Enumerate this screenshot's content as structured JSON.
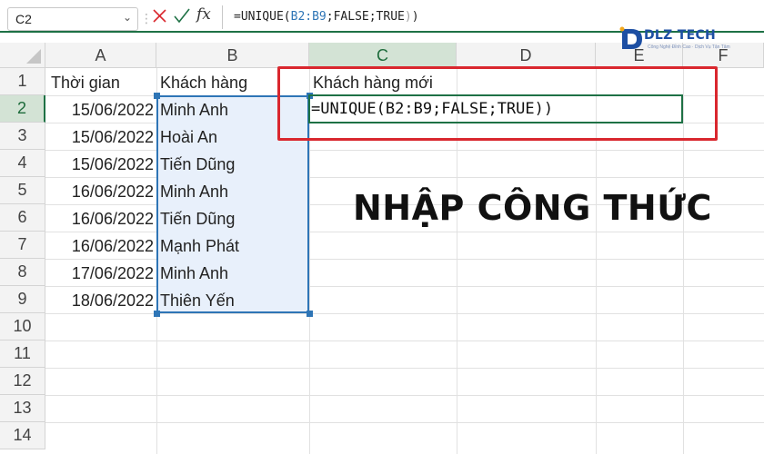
{
  "formula_bar": {
    "name_box": "C2",
    "formula_parts": [
      "=UNIQUE(",
      "B2:B9",
      ";FALSE;TRUE",
      ")",
      ")"
    ],
    "cancel_icon": "x-icon",
    "enter_icon": "check-icon",
    "function_icon": "fx"
  },
  "columns": [
    "A",
    "B",
    "C",
    "D",
    "E",
    "F"
  ],
  "selected_column": "C",
  "rows": [
    "1",
    "2",
    "3",
    "4",
    "5",
    "6",
    "7",
    "8",
    "9",
    "10",
    "11",
    "12",
    "13",
    "14"
  ],
  "selected_row": "2",
  "headers": {
    "a1": "Thời gian",
    "b1": "Khách hàng",
    "c1": "Khách hàng mới"
  },
  "table": [
    {
      "date": "15/06/2022",
      "customer": "Minh Anh"
    },
    {
      "date": "15/06/2022",
      "customer": "Hoài An"
    },
    {
      "date": "15/06/2022",
      "customer": "Tiến Dũng"
    },
    {
      "date": "16/06/2022",
      "customer": "Minh Anh"
    },
    {
      "date": "16/06/2022",
      "customer": "Tiến Dũng"
    },
    {
      "date": "16/06/2022",
      "customer": "Mạnh Phát"
    },
    {
      "date": "17/06/2022",
      "customer": "Minh Anh"
    },
    {
      "date": "18/06/2022",
      "customer": "Thiên Yến"
    }
  ],
  "active_cell_text": "=UNIQUE(B2:B9;FALSE;TRUE))",
  "annotation": "NHẬP CÔNG THỨC",
  "logo": {
    "text": "DLZ TECH",
    "tagline": "Công Nghệ Đỉnh Cao · Dịch Vụ Tận Tâm"
  },
  "colors": {
    "accent_green": "#1e7145",
    "range_blue": "#2e75b6",
    "highlight_red": "#d9272e"
  }
}
